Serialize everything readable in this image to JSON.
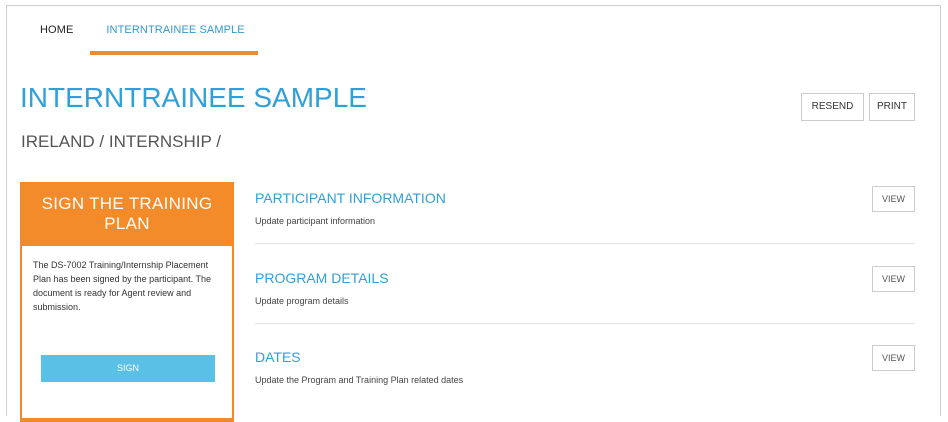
{
  "nav": {
    "tabs": [
      {
        "label": "HOME",
        "active": false
      },
      {
        "label": "INTERNTRAINEE SAMPLE",
        "active": true
      }
    ]
  },
  "header": {
    "title": "INTERNTRAINEE SAMPLE",
    "breadcrumb": "IRELAND / INTERNSHIP /",
    "resend_label": "RESEND",
    "print_label": "PRINT"
  },
  "sign_card": {
    "title": "SIGN THE TRAINING PLAN",
    "body": "The DS-7002 Training/Internship Placement Plan has been signed by the participant. The document is ready for Agent review and submission.",
    "button_label": "SIGN"
  },
  "sections": [
    {
      "title": "PARTICIPANT INFORMATION",
      "description": "Update participant information",
      "view_label": "VIEW"
    },
    {
      "title": "PROGRAM DETAILS",
      "description": "Update program details",
      "view_label": "VIEW"
    },
    {
      "title": "DATES",
      "description": "Update the Program and Training Plan related dates",
      "view_label": "VIEW"
    }
  ],
  "colors": {
    "accent_blue": "#2fa0d8",
    "accent_orange": "#f08a2c",
    "sign_button": "#5bc0e6"
  }
}
